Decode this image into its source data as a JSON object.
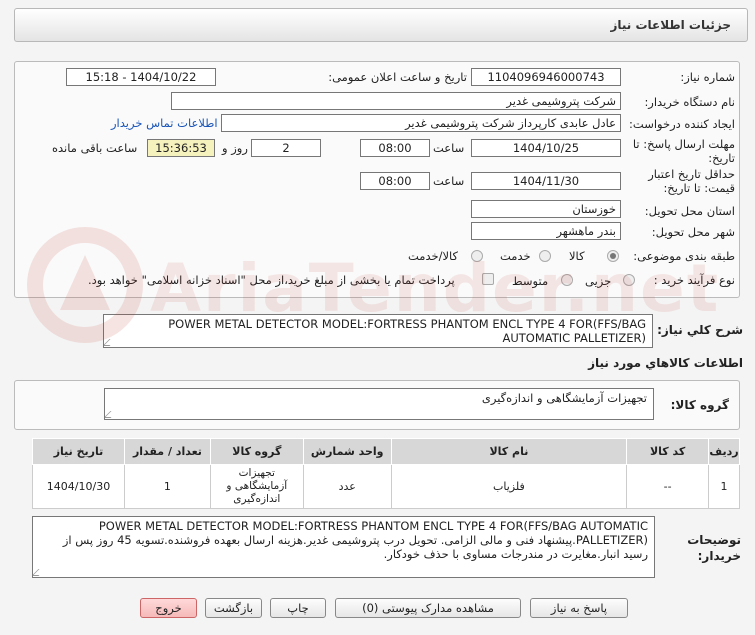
{
  "page": {
    "title": "جزئیات اطلاعات نیاز"
  },
  "form": {
    "need_number_label": "شماره نیاز:",
    "need_number": "1104096946000743",
    "announce_label": "تاریخ و ساعت اعلان عمومی:",
    "announce_value": "1404/10/22 - 15:18",
    "buyer_org_label": "نام دستگاه خریدار:",
    "buyer_org": "شرکت پتروشیمی غدیر",
    "creator_label": "ایجاد کننده درخواست:",
    "creator": "عادل عابدی کارپرداز شرکت پتروشیمی غدیر",
    "contact_link": "اطلاعات تماس خریدار",
    "deadline_label_1": "مهلت ارسال پاسخ: تا",
    "deadline_label_2": "تاریخ:",
    "deadline_date": "1404/10/25",
    "time_label": "ساعت",
    "deadline_time": "08:00",
    "days_value": "2",
    "days_label": "روز و",
    "remaining_time": "15:36:53",
    "remaining_label": "ساعت باقی مانده",
    "validity_label_1": "حداقل تاریخ اعتبار",
    "validity_label_2": "قیمت: تا تاریخ:",
    "validity_date": "1404/11/30",
    "validity_time": "08:00",
    "province_label": "استان محل تحویل:",
    "province": "خوزستان",
    "city_label": "شهر محل تحویل:",
    "city": "بندر ماهشهر",
    "category_label": "طبقه بندی موضوعی:",
    "category_options": [
      "کالا",
      "خدمت",
      "کالا/خدمت"
    ],
    "process_label": "نوع فرآیند خرید :",
    "process_options": [
      "جزیی",
      "متوسط"
    ],
    "payment_note": "پرداخت تمام یا بخشی از مبلغ خرید،از محل \"اسناد خزانه اسلامی\" خواهد بود."
  },
  "description": {
    "label": "شرح كلي نياز:",
    "text": "POWER METAL DETECTOR  MODEL:FORTRESS PHANTOM ENCL TYPE 4   FOR(FFS/BAG AUTOMATIC PALLETIZER)"
  },
  "goods": {
    "section_title": "اطلاعات کالاهاي مورد نياز",
    "group_label": "گروه کالا:",
    "group_value": "تجهیزات آزمایشگاهی و اندازه‌گیری"
  },
  "table": {
    "headers": [
      "ردیف",
      "کد کالا",
      "نام کالا",
      "واحد شمارش",
      "گروه کالا",
      "تعداد / مقدار",
      "تاریخ نیاز"
    ],
    "rows": [
      [
        "1",
        "--",
        "فلزیاب",
        "عدد",
        "تجهیزات آزمایشگاهی و اندازه‌گیری",
        "1",
        "1404/10/30"
      ]
    ]
  },
  "buyer_notes": {
    "label_1": "توضیحات",
    "label_2": "خریدار:",
    "text": "POWER METAL DETECTOR  MODEL:FORTRESS PHANTOM ENCL TYPE 4   FOR(FFS/BAG AUTOMATIC PALLETIZER).پیشنهاد فنی و مالی الزامی. تحویل درب پتروشیمی غدیر.هزینه ارسال بعهده فروشنده.تسویه 45 روز پس از رسید انبار.مغایرت در مندرجات مساوی با حذف خودکار."
  },
  "buttons": {
    "reply": "پاسخ به نیاز",
    "attachments": "مشاهده مدارک پیوستی (0)",
    "print": "چاپ",
    "back": "بازگشت",
    "exit": "خروج"
  },
  "watermark": {
    "text": "AriaTender.net"
  },
  "colors": {
    "highlight": "#f6f2bd",
    "link": "#1a55b8",
    "exit_button": "#f6b9b9"
  }
}
